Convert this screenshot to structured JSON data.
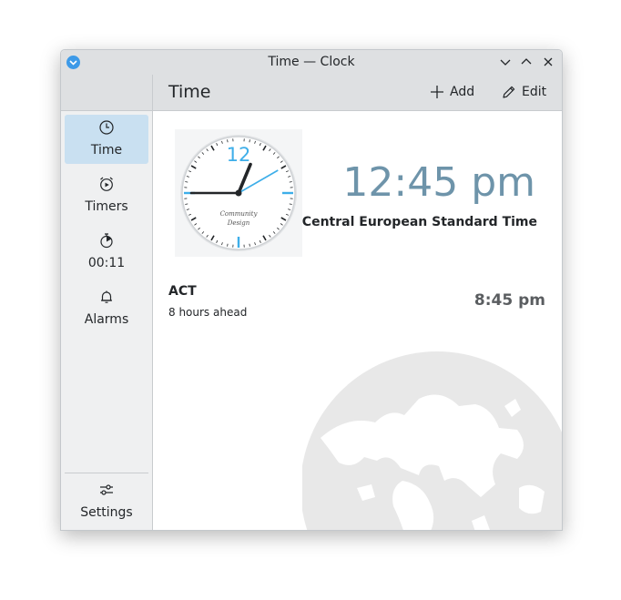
{
  "window": {
    "title": "Time — Clock"
  },
  "sidebar": {
    "items": [
      {
        "label": "Time",
        "icon": "clock-icon",
        "active": true
      },
      {
        "label": "Timers",
        "icon": "timer-icon",
        "active": false
      },
      {
        "label": "00:11",
        "icon": "stopwatch-icon",
        "active": false
      },
      {
        "label": "Alarms",
        "icon": "bell-icon",
        "active": false
      }
    ],
    "settings_label": "Settings"
  },
  "header": {
    "title": "Time",
    "add_label": "Add",
    "edit_label": "Edit"
  },
  "local": {
    "time": "12:45 pm",
    "timezone": "Central European Standard Time",
    "clock_face": {
      "numeral": "12",
      "brand_line1": "Community",
      "brand_line2": "Design",
      "hour": 12,
      "minute": 45,
      "second": 10
    }
  },
  "world_clocks": [
    {
      "city": "ACT",
      "offset": "8 hours ahead",
      "time": "8:45 pm"
    }
  ],
  "colors": {
    "accent": "#3daee9",
    "time_text": "#6e94aa",
    "active_nav": "#c9e0f1",
    "header_bg": "#dee0e2",
    "sidebar_bg": "#eff0f1"
  }
}
